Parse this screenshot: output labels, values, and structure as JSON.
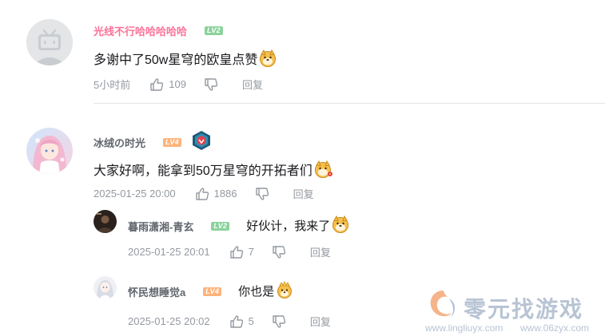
{
  "comments": [
    {
      "username": "光线不行哈哈哈哈哈",
      "username_color": "#fb7299",
      "level": "LV2",
      "content": "多谢中了50w星穹的欧皇点赞",
      "emoji": "doge-emoji",
      "time": "5小时前",
      "likes": "109",
      "reply_label": "回复"
    },
    {
      "username": "冰绒の时光",
      "username_color": "#61666d",
      "level": "LV4",
      "badge": "medal-badge",
      "content": "大家好啊，能拿到50万星穹的开拓者们",
      "emoji": "doge-flower-emoji",
      "time": "2025-01-25 20:00",
      "likes": "1886",
      "reply_label": "回复",
      "replies": [
        {
          "username": "暮雨潇湘-青玄",
          "level": "LV2",
          "content": "好伙计，我来了",
          "emoji": "doge-emoji",
          "time": "2025-01-25 20:01",
          "likes": "7",
          "reply_label": "回复"
        },
        {
          "username": "怀民想睡觉a",
          "level": "LV4",
          "content": "你也是",
          "emoji": "doge-crown-emoji",
          "time": "2025-01-25 20:02",
          "likes": "5",
          "reply_label": "回复"
        }
      ]
    }
  ],
  "watermark": {
    "title": "零元找游戏",
    "url_left": "www.lingliuyx.com",
    "url_right": "www.06zyx.com"
  },
  "colors": {
    "pink": "#fb7299",
    "gray_text": "#9499a0",
    "lv2": "#8bd29b",
    "lv4": "#feb37a"
  }
}
